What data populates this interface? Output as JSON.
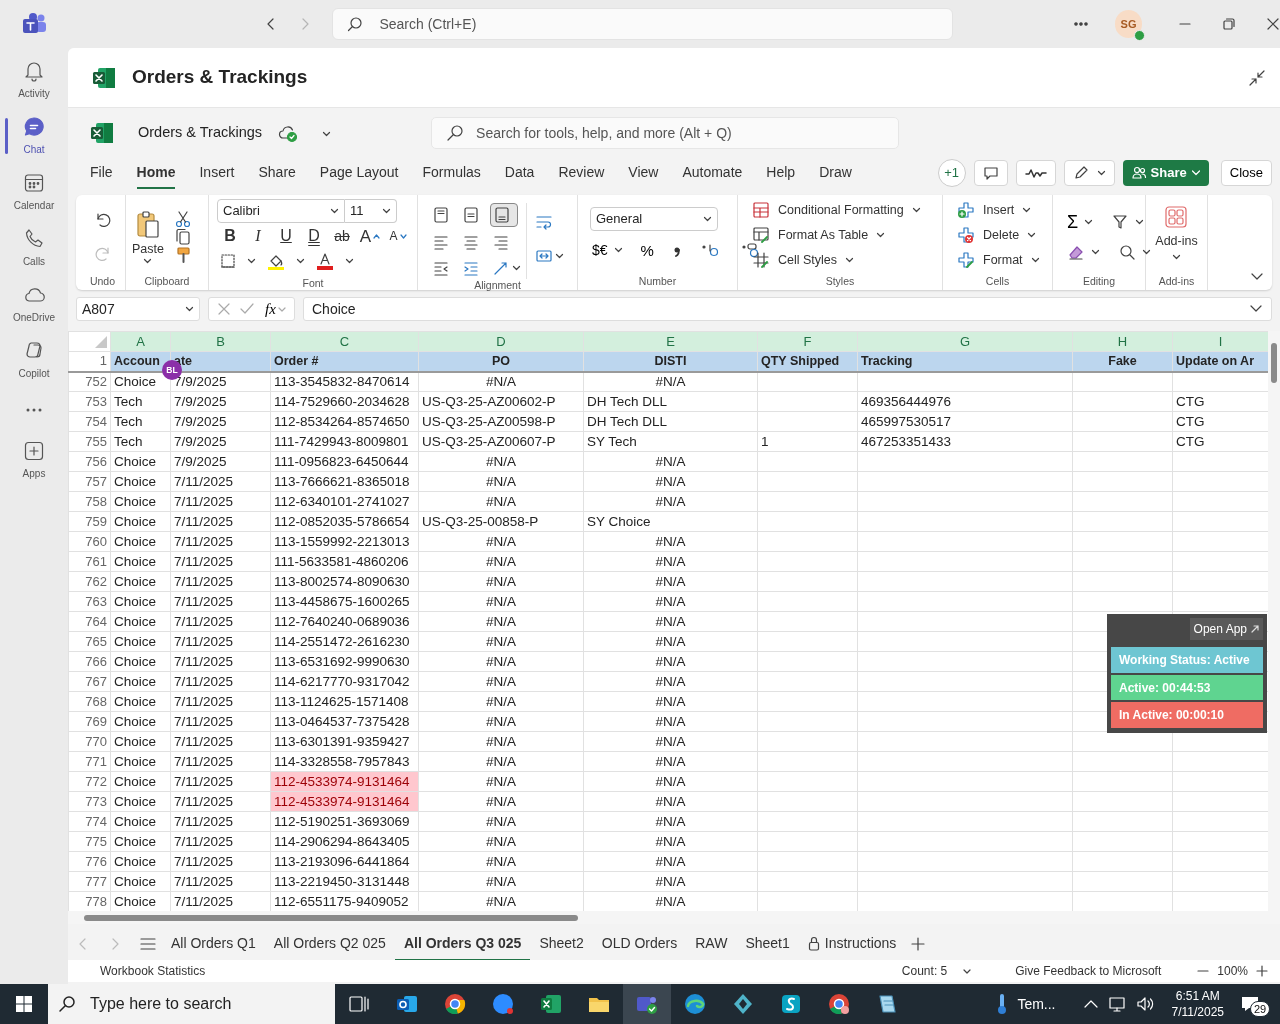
{
  "app_bar": {
    "search": {
      "placeholder": "Search (Ctrl+E)"
    },
    "avatar": "SG"
  },
  "sidebar": [
    {
      "label": "Activity",
      "selected": false
    },
    {
      "label": "Chat",
      "selected": true
    },
    {
      "label": "Calendar",
      "selected": false
    },
    {
      "label": "Calls",
      "selected": false
    },
    {
      "label": "OneDrive",
      "selected": false
    },
    {
      "label": "Copilot",
      "selected": false
    },
    {
      "label": "Apps",
      "selected": false
    }
  ],
  "file_title": "Orders & Trackings",
  "excel_bar": {
    "doc_name": "Orders & Trackings",
    "search": {
      "placeholder": "Search for tools, help, and more (Alt + Q)"
    }
  },
  "menu_tabs": [
    {
      "label": "File",
      "selected": false
    },
    {
      "label": "Home",
      "selected": true
    },
    {
      "label": "Insert",
      "selected": false
    },
    {
      "label": "Share",
      "selected": false
    },
    {
      "label": "Page Layout",
      "selected": false
    },
    {
      "label": "Formulas",
      "selected": false
    },
    {
      "label": "Data",
      "selected": false
    },
    {
      "label": "Review",
      "selected": false
    },
    {
      "label": "View",
      "selected": false
    },
    {
      "label": "Automate",
      "selected": false
    },
    {
      "label": "Help",
      "selected": false
    },
    {
      "label": "Draw",
      "selected": false
    }
  ],
  "toolbar": {
    "coauthors": "+1",
    "share": "Share",
    "close": "Close"
  },
  "ribbon": {
    "groups": [
      "Undo",
      "Clipboard",
      "Font",
      "Alignment",
      "Number",
      "Styles",
      "Cells",
      "Editing",
      "Add-ins"
    ],
    "paste": "Paste",
    "font_name": "Calibri",
    "font_size": "11",
    "format_buttons": [
      "B",
      "I",
      "U",
      "D",
      "ab",
      "A",
      "A"
    ],
    "number_format": "General",
    "number_buttons": [
      "$€",
      "%"
    ],
    "styles": [
      "Conditional Formatting",
      "Format As Table",
      "Cell Styles"
    ],
    "cells": [
      "Insert",
      "Delete",
      "Format"
    ],
    "sum": "Σ",
    "addins": "Add-ins"
  },
  "formula_bar": {
    "name_box": "A807",
    "fx": "fx",
    "formula": "Choice"
  },
  "grid": {
    "columns": [
      {
        "letter": "A",
        "selected": true
      },
      {
        "letter": "B",
        "selected": true
      },
      {
        "letter": "C",
        "selected": true
      },
      {
        "letter": "D",
        "selected": true
      },
      {
        "letter": "E",
        "selected": true
      },
      {
        "letter": "F",
        "selected": true
      },
      {
        "letter": "G",
        "selected": true
      },
      {
        "letter": "H",
        "selected": true
      },
      {
        "letter": "I",
        "selected": true
      }
    ],
    "header_row": "1",
    "headers": [
      {
        "text": "Accoun",
        "centered": false
      },
      {
        "text": "ate",
        "centered": false
      },
      {
        "text": "Order #",
        "centered": false
      },
      {
        "text": "PO",
        "centered": true
      },
      {
        "text": "DISTI",
        "centered": true
      },
      {
        "text": "QTY Shipped",
        "centered": false
      },
      {
        "text": "Tracking",
        "centered": false
      },
      {
        "text": "Fake",
        "centered": true
      },
      {
        "text": "Update on Ar",
        "centered": false
      }
    ],
    "presence_badge": "BL",
    "rows": [
      {
        "row": "752",
        "account": "Choice",
        "date": "7/9/2025",
        "order": "113-3545832-8470614",
        "po": "#N/A",
        "disti": "#N/A",
        "error": true,
        "flagged": false
      },
      {
        "row": "753",
        "account": "Tech",
        "date": "7/9/2025",
        "order": "114-7529660-2034628",
        "po": "US-Q3-25-AZ00602-P",
        "disti": "DH Tech DLL",
        "tracking": "469356444976",
        "update": "CTG",
        "error": false,
        "flagged": false
      },
      {
        "row": "754",
        "account": "Tech",
        "date": "7/9/2025",
        "order": "112-8534264-8574650",
        "po": "US-Q3-25-AZ00598-P",
        "disti": "DH Tech DLL",
        "tracking": "465997530517",
        "update": "CTG",
        "error": false,
        "flagged": false
      },
      {
        "row": "755",
        "account": "Tech",
        "date": "7/9/2025",
        "order": "111-7429943-8009801",
        "po": "US-Q3-25-AZ00607-P",
        "disti": "SY Tech",
        "qty": "1",
        "tracking": "467253351433",
        "update": "CTG",
        "error": false,
        "flagged": false
      },
      {
        "row": "756",
        "account": "Choice",
        "date": "7/9/2025",
        "order": "111-0956823-6450644",
        "po": "#N/A",
        "disti": "#N/A",
        "error": true,
        "flagged": false
      },
      {
        "row": "757",
        "account": "Choice",
        "date": "7/11/2025",
        "order": "113-7666621-8365018",
        "po": "#N/A",
        "disti": "#N/A",
        "error": true,
        "flagged": false
      },
      {
        "row": "758",
        "account": "Choice",
        "date": "7/11/2025",
        "order": "112-6340101-2741027",
        "po": "#N/A",
        "disti": "#N/A",
        "error": true,
        "flagged": false
      },
      {
        "row": "759",
        "account": "Choice",
        "date": "7/11/2025",
        "order": "112-0852035-5786654",
        "po": "US-Q3-25-00858-P",
        "disti": "SY Choice",
        "error": false,
        "flagged": false
      },
      {
        "row": "760",
        "account": "Choice",
        "date": "7/11/2025",
        "order": "113-1559992-2213013",
        "po": "#N/A",
        "disti": "#N/A",
        "error": true,
        "flagged": false
      },
      {
        "row": "761",
        "account": "Choice",
        "date": "7/11/2025",
        "order": "111-5633581-4860206",
        "po": "#N/A",
        "disti": "#N/A",
        "error": true,
        "flagged": false
      },
      {
        "row": "762",
        "account": "Choice",
        "date": "7/11/2025",
        "order": "113-8002574-8090630",
        "po": "#N/A",
        "disti": "#N/A",
        "error": true,
        "flagged": false
      },
      {
        "row": "763",
        "account": "Choice",
        "date": "7/11/2025",
        "order": "113-4458675-1600265",
        "po": "#N/A",
        "disti": "#N/A",
        "error": true,
        "flagged": false
      },
      {
        "row": "764",
        "account": "Choice",
        "date": "7/11/2025",
        "order": "112-7640240-0689036",
        "po": "#N/A",
        "disti": "#N/A",
        "error": true,
        "flagged": false
      },
      {
        "row": "765",
        "account": "Choice",
        "date": "7/11/2025",
        "order": "114-2551472-2616230",
        "po": "#N/A",
        "disti": "#N/A",
        "error": true,
        "flagged": false
      },
      {
        "row": "766",
        "account": "Choice",
        "date": "7/11/2025",
        "order": "113-6531692-9990630",
        "po": "#N/A",
        "disti": "#N/A",
        "error": true,
        "flagged": false
      },
      {
        "row": "767",
        "account": "Choice",
        "date": "7/11/2025",
        "order": "114-6217770-9317042",
        "po": "#N/A",
        "disti": "#N/A",
        "error": true,
        "flagged": false
      },
      {
        "row": "768",
        "account": "Choice",
        "date": "7/11/2025",
        "order": "113-1124625-1571408",
        "po": "#N/A",
        "disti": "#N/A",
        "error": true,
        "flagged": false
      },
      {
        "row": "769",
        "account": "Choice",
        "date": "7/11/2025",
        "order": "113-0464537-7375428",
        "po": "#N/A",
        "disti": "#N/A",
        "error": true,
        "flagged": false
      },
      {
        "row": "770",
        "account": "Choice",
        "date": "7/11/2025",
        "order": "113-6301391-9359427",
        "po": "#N/A",
        "disti": "#N/A",
        "error": true,
        "flagged": false
      },
      {
        "row": "771",
        "account": "Choice",
        "date": "7/11/2025",
        "order": "114-3328558-7957843",
        "po": "#N/A",
        "disti": "#N/A",
        "error": true,
        "flagged": false
      },
      {
        "row": "772",
        "account": "Choice",
        "date": "7/11/2025",
        "order": "112-4533974-9131464",
        "po": "#N/A",
        "disti": "#N/A",
        "error": true,
        "flagged": true
      },
      {
        "row": "773",
        "account": "Choice",
        "date": "7/11/2025",
        "order": "112-4533974-9131464",
        "po": "#N/A",
        "disti": "#N/A",
        "error": true,
        "flagged": true
      },
      {
        "row": "774",
        "account": "Choice",
        "date": "7/11/2025",
        "order": "112-5190251-3693069",
        "po": "#N/A",
        "disti": "#N/A",
        "error": true,
        "flagged": false
      },
      {
        "row": "775",
        "account": "Choice",
        "date": "7/11/2025",
        "order": "114-2906294-8643405",
        "po": "#N/A",
        "disti": "#N/A",
        "error": true,
        "flagged": false
      },
      {
        "row": "776",
        "account": "Choice",
        "date": "7/11/2025",
        "order": "113-2193096-6441864",
        "po": "#N/A",
        "disti": "#N/A",
        "error": true,
        "flagged": false
      },
      {
        "row": "777",
        "account": "Choice",
        "date": "7/11/2025",
        "order": "113-2219450-3131448",
        "po": "#N/A",
        "disti": "#N/A",
        "error": true,
        "flagged": false
      },
      {
        "row": "778",
        "account": "Choice",
        "date": "7/11/2025",
        "order": "112-6551175-9409052",
        "po": "#N/A",
        "disti": "#N/A",
        "error": true,
        "flagged": false
      }
    ]
  },
  "status_widget": {
    "open_app": "Open App",
    "statuses": [
      {
        "text": "Working Status: Active",
        "color": "#6ec6d2"
      },
      {
        "text": "Active: 00:44:53",
        "color": "#5fd490"
      },
      {
        "text": "In Active: 00:00:10",
        "color": "#ef6c63"
      }
    ]
  },
  "sheet_tabs": [
    {
      "label": "All Orders Q1",
      "selected": false,
      "locked": false
    },
    {
      "label": "All Orders Q2 025",
      "selected": false,
      "locked": false
    },
    {
      "label": "All Orders Q3 025",
      "selected": true,
      "locked": false
    },
    {
      "label": "Sheet2",
      "selected": false,
      "locked": false
    },
    {
      "label": "OLD Orders",
      "selected": false,
      "locked": false
    },
    {
      "label": "RAW",
      "selected": false,
      "locked": false
    },
    {
      "label": "Sheet1",
      "selected": false,
      "locked": false
    },
    {
      "label": "Instructions",
      "selected": false,
      "locked": true
    }
  ],
  "status_bar": {
    "workbook_statistics": "Workbook Statistics",
    "count": "Count: 5",
    "feedback": "Give Feedback to Microsoft",
    "zoom": "100%"
  },
  "taskbar": {
    "search": {
      "placeholder": "Type here to search"
    },
    "weather": "Tem...",
    "time": "6:51 AM",
    "date": "7/11/2025",
    "notifications": "29"
  }
}
